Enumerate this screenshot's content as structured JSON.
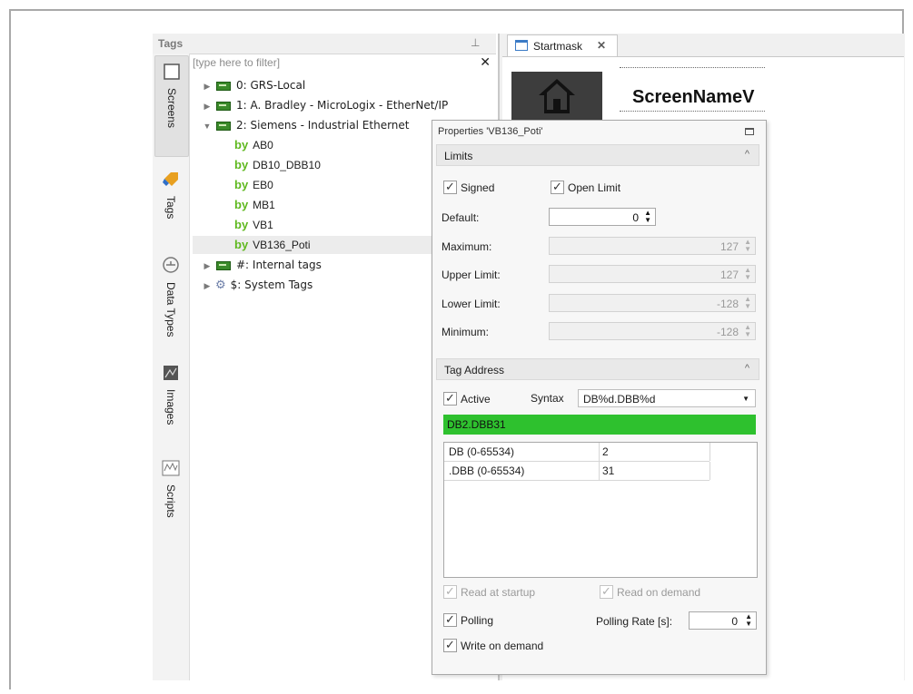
{
  "tags_panel": {
    "title": "Tags",
    "filter_placeholder": "[type here to filter]",
    "clear_label": "✕",
    "pin_label": "⊥",
    "vertical_tabs": [
      {
        "label": "Screens",
        "icon": "screen-icon"
      },
      {
        "label": "Tags",
        "icon": "tag-icon"
      },
      {
        "label": "Data Types",
        "icon": "datatype-icon"
      },
      {
        "label": "Images",
        "icon": "image-icon"
      },
      {
        "label": "Scripts",
        "icon": "script-icon"
      }
    ],
    "tree": [
      {
        "label": "0: GRS-Local",
        "icon": "network-card-icon",
        "expanded": false
      },
      {
        "label": "1: A. Bradley - MicroLogix - EtherNet/IP",
        "icon": "network-card-icon",
        "expanded": false
      },
      {
        "label": "2: Siemens - Industrial Ethernet",
        "icon": "network-card-icon",
        "expanded": true
      },
      {
        "label": "#: Internal tags",
        "icon": "network-card-icon",
        "expanded": false
      },
      {
        "label": "$: System Tags",
        "icon": "gear-icon",
        "expanded": false
      }
    ],
    "byte_prefix": "by",
    "siemens_tags": [
      "AB0",
      "DB10_DBB10",
      "EB0",
      "MB1",
      "VB1",
      "VB136_Poti"
    ],
    "selected_tag": "VB136_Poti"
  },
  "document": {
    "tab_label": "Startmask",
    "tab_close": "✕",
    "screen_name": "ScreenNameV"
  },
  "properties": {
    "title": "Properties 'VB136_Poti'",
    "limits": {
      "header": "Limits",
      "signed_label": "Signed",
      "open_limit_label": "Open Limit",
      "default_label": "Default:",
      "default_value": "0",
      "maximum_label": "Maximum:",
      "maximum_value": "127",
      "upper_label": "Upper Limit:",
      "upper_value": "127",
      "lower_label": "Lower Limit:",
      "lower_value": "-128",
      "minimum_label": "Minimum:",
      "minimum_value": "-128"
    },
    "tag_address": {
      "header": "Tag Address",
      "active_label": "Active",
      "syntax_label": "Syntax",
      "syntax_value": "DB%d.DBB%d",
      "address": "DB2.DBB31",
      "rows": [
        {
          "key": "DB (0-65534)",
          "value": "2"
        },
        {
          "key": ".DBB (0-65534)",
          "value": "31"
        }
      ],
      "read_startup_label": "Read at startup",
      "read_demand_label": "Read on demand",
      "polling_label": "Polling",
      "polling_rate_label": "Polling Rate [s]:",
      "polling_rate_value": "0",
      "write_demand_label": "Write on demand"
    },
    "check_mark": "✓",
    "collapse_glyph": "^",
    "spin_glyph": "▲▼"
  },
  "colors": {
    "address_valid": "#2ec12e",
    "byte_prefix": "#5fb81f",
    "nic_green": "#3a8a2a"
  }
}
